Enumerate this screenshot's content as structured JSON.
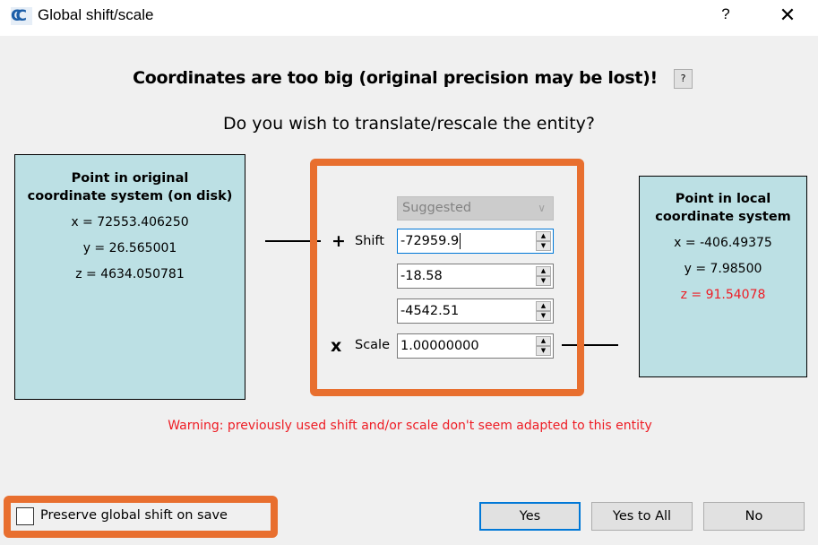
{
  "window": {
    "title": "Global shift/scale",
    "app_icon": "cloudcompare-icon",
    "help_label": "?",
    "close_label": "✕"
  },
  "header": {
    "headline": "Coordinates are too big (original precision may be lost)!",
    "help_button_label": "?",
    "question": "Do you wish to translate/rescale the entity?"
  },
  "original_point": {
    "title_line1": "Point in original",
    "title_line2": "coordinate system (on disk)",
    "x": "x = 72553.406250",
    "y": "y = 26.565001",
    "z": "z = 4634.050781"
  },
  "local_point": {
    "title_line1": "Point in local",
    "title_line2": "coordinate system",
    "x": "x = -406.49375",
    "y": "y = 7.98500",
    "z": "z = 91.54078",
    "z_color": "#ee1c24"
  },
  "transform": {
    "preset_combo": {
      "selected": "Suggested",
      "enabled": false
    },
    "shift_sign": "+",
    "shift_label": "Shift",
    "shift_x": "-72959.9",
    "shift_y": "-18.58",
    "shift_z": "-4542.51",
    "scale_sign": "x",
    "scale_label": "Scale",
    "scale": "1.00000000"
  },
  "warning": "Warning: previously used shift and/or scale don't seem adapted to this entity",
  "preserve_checkbox": {
    "label": "Preserve global shift on save",
    "checked": false
  },
  "buttons": {
    "yes": "Yes",
    "yes_to_all": "Yes to All",
    "no": "No"
  },
  "colors": {
    "highlight": "#e86f2f",
    "panel_bg": "#bce0e4",
    "warning": "#ee1c24",
    "focus": "#0078d7"
  }
}
